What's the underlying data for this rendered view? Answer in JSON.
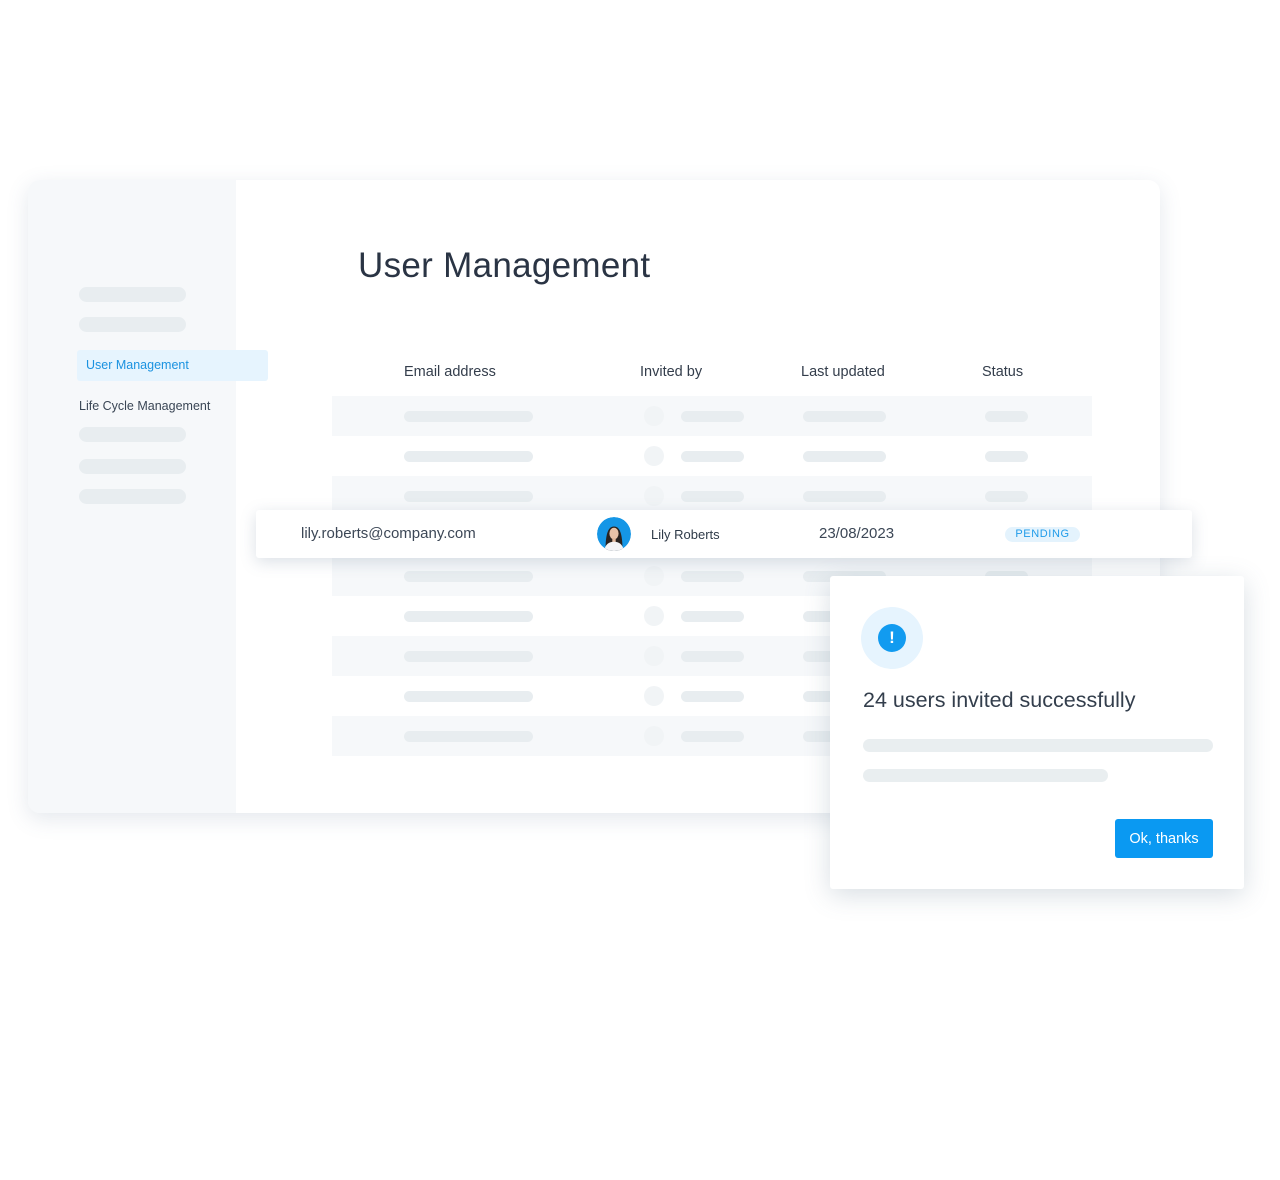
{
  "page": {
    "title": "User Management"
  },
  "sidebar": {
    "items": [
      {
        "label": "User Management",
        "active": true
      },
      {
        "label": "Life Cycle Management",
        "active": false
      }
    ]
  },
  "table": {
    "columns": [
      "Email address",
      "Invited by",
      "Last updated",
      "Status"
    ],
    "highlighted_row": {
      "email": "lily.roberts@company.com",
      "invited_by": "Lily Roberts",
      "last_updated": "23/08/2023",
      "status": "PENDING"
    }
  },
  "modal": {
    "icon": "alert-icon",
    "title": "24 users invited successfully",
    "button_label": "Ok, thanks"
  },
  "colors": {
    "accent": "#0a99f2",
    "active_nav_bg": "#e6f4fe",
    "pending_badge_text": "#1f9be9"
  }
}
